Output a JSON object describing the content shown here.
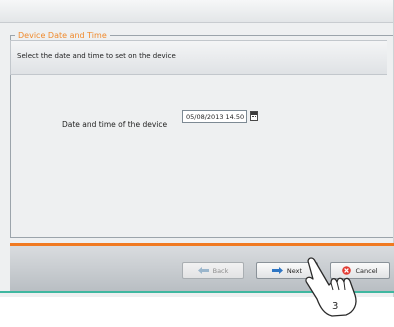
{
  "group": {
    "title": "Device Date and Time"
  },
  "instruction": "Select the date and time to set on the device",
  "datetime": {
    "label": "Date and time of the device",
    "value": "05/08/2013 14.50"
  },
  "buttons": {
    "back": "Back",
    "next": "Next",
    "cancel": "Cancel"
  },
  "callout": {
    "step": "3"
  },
  "colors": {
    "accent_orange": "#f07a22",
    "accent_teal": "#3fb7a0"
  }
}
